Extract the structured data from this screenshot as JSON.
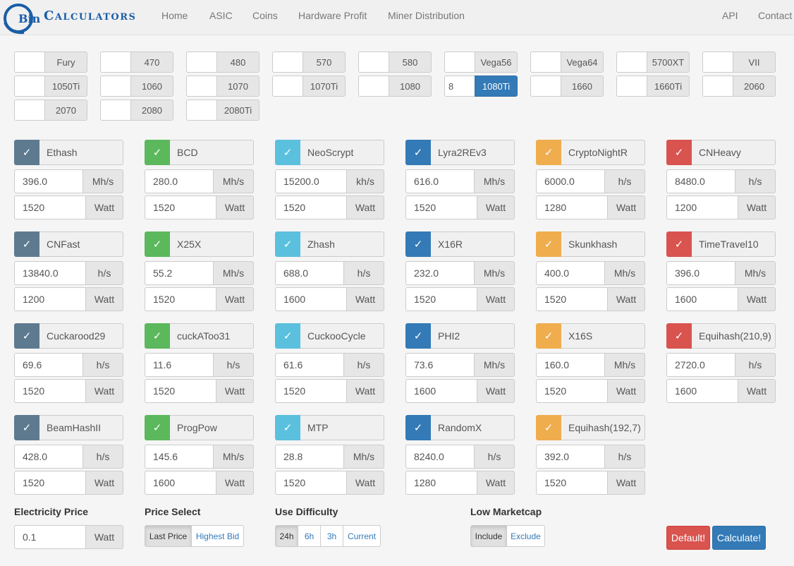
{
  "nav": {
    "brand_b": "Bin",
    "brand_rest": "Calculators",
    "links": [
      "Home",
      "ASIC",
      "Coins",
      "Hardware Profit",
      "Miner Distribution",
      "API",
      "Contact"
    ]
  },
  "gpus": [
    {
      "label": "Fury",
      "value": ""
    },
    {
      "label": "470",
      "value": ""
    },
    {
      "label": "480",
      "value": ""
    },
    {
      "label": "570",
      "value": ""
    },
    {
      "label": "580",
      "value": ""
    },
    {
      "label": "Vega56",
      "value": ""
    },
    {
      "label": "Vega64",
      "value": ""
    },
    {
      "label": "5700XT",
      "value": ""
    },
    {
      "label": "VII",
      "value": ""
    },
    {
      "label": "1050Ti",
      "value": ""
    },
    {
      "label": "1060",
      "value": ""
    },
    {
      "label": "1070",
      "value": ""
    },
    {
      "label": "1070Ti",
      "value": ""
    },
    {
      "label": "1080",
      "value": ""
    },
    {
      "label": "1080Ti",
      "value": "8"
    },
    {
      "label": "1660",
      "value": ""
    },
    {
      "label": "1660Ti",
      "value": ""
    },
    {
      "label": "2060",
      "value": ""
    },
    {
      "label": "2070",
      "value": ""
    },
    {
      "label": "2080",
      "value": ""
    },
    {
      "label": "2080Ti",
      "value": ""
    }
  ],
  "algos": [
    {
      "name": "Ethash",
      "hash": "396.0",
      "unit": "Mh/s",
      "power": "1520",
      "power_unit": "Watt"
    },
    {
      "name": "BCD",
      "hash": "280.0",
      "unit": "Mh/s",
      "power": "1520",
      "power_unit": "Watt"
    },
    {
      "name": "NeoScrypt",
      "hash": "15200.0",
      "unit": "kh/s",
      "power": "1520",
      "power_unit": "Watt"
    },
    {
      "name": "Lyra2REv3",
      "hash": "616.0",
      "unit": "Mh/s",
      "power": "1520",
      "power_unit": "Watt"
    },
    {
      "name": "CryptoNightR",
      "hash": "6000.0",
      "unit": "h/s",
      "power": "1280",
      "power_unit": "Watt"
    },
    {
      "name": "CNHeavy",
      "hash": "8480.0",
      "unit": "h/s",
      "power": "1200",
      "power_unit": "Watt"
    },
    {
      "name": "CNFast",
      "hash": "13840.0",
      "unit": "h/s",
      "power": "1200",
      "power_unit": "Watt"
    },
    {
      "name": "X25X",
      "hash": "55.2",
      "unit": "Mh/s",
      "power": "1520",
      "power_unit": "Watt"
    },
    {
      "name": "Zhash",
      "hash": "688.0",
      "unit": "h/s",
      "power": "1600",
      "power_unit": "Watt"
    },
    {
      "name": "X16R",
      "hash": "232.0",
      "unit": "Mh/s",
      "power": "1520",
      "power_unit": "Watt"
    },
    {
      "name": "Skunkhash",
      "hash": "400.0",
      "unit": "Mh/s",
      "power": "1520",
      "power_unit": "Watt"
    },
    {
      "name": "TimeTravel10",
      "hash": "396.0",
      "unit": "Mh/s",
      "power": "1600",
      "power_unit": "Watt"
    },
    {
      "name": "Cuckarood29",
      "hash": "69.6",
      "unit": "h/s",
      "power": "1520",
      "power_unit": "Watt"
    },
    {
      "name": "cuckAToo31",
      "hash": "11.6",
      "unit": "h/s",
      "power": "1520",
      "power_unit": "Watt"
    },
    {
      "name": "CuckooCycle",
      "hash": "61.6",
      "unit": "h/s",
      "power": "1520",
      "power_unit": "Watt"
    },
    {
      "name": "PHI2",
      "hash": "73.6",
      "unit": "Mh/s",
      "power": "1600",
      "power_unit": "Watt"
    },
    {
      "name": "X16S",
      "hash": "160.0",
      "unit": "Mh/s",
      "power": "1520",
      "power_unit": "Watt"
    },
    {
      "name": "Equihash(210,9)",
      "hash": "2720.0",
      "unit": "h/s",
      "power": "1600",
      "power_unit": "Watt"
    },
    {
      "name": "BeamHashII",
      "hash": "428.0",
      "unit": "h/s",
      "power": "1520",
      "power_unit": "Watt"
    },
    {
      "name": "ProgPow",
      "hash": "145.6",
      "unit": "Mh/s",
      "power": "1600",
      "power_unit": "Watt"
    },
    {
      "name": "MTP",
      "hash": "28.8",
      "unit": "Mh/s",
      "power": "1520",
      "power_unit": "Watt"
    },
    {
      "name": "RandomX",
      "hash": "8240.0",
      "unit": "h/s",
      "power": "1280",
      "power_unit": "Watt"
    },
    {
      "name": "Equihash(192,7)",
      "hash": "392.0",
      "unit": "h/s",
      "power": "1520",
      "power_unit": "Watt"
    }
  ],
  "check_glyph": "✓",
  "colors": [
    "#5e7a8f",
    "#5cb85c",
    "#5bc0de",
    "#337ab7",
    "#f0ad4e",
    "#d9534f"
  ],
  "settings": {
    "electricity": {
      "label": "Electricity Price",
      "value": "0.1",
      "unit": "Watt"
    },
    "price_select": {
      "label": "Price Select",
      "options": [
        "Last Price",
        "Highest Bid"
      ],
      "selected": "Last Price"
    },
    "difficulty": {
      "label": "Use Difficulty",
      "options": [
        "24h",
        "6h",
        "3h",
        "Current"
      ],
      "selected": "24h"
    },
    "marketcap": {
      "label": "Low Marketcap",
      "options": [
        "Include",
        "Exclude"
      ],
      "selected": "Include"
    }
  },
  "buttons": {
    "default": "Default!",
    "calculate": "Calculate!"
  }
}
